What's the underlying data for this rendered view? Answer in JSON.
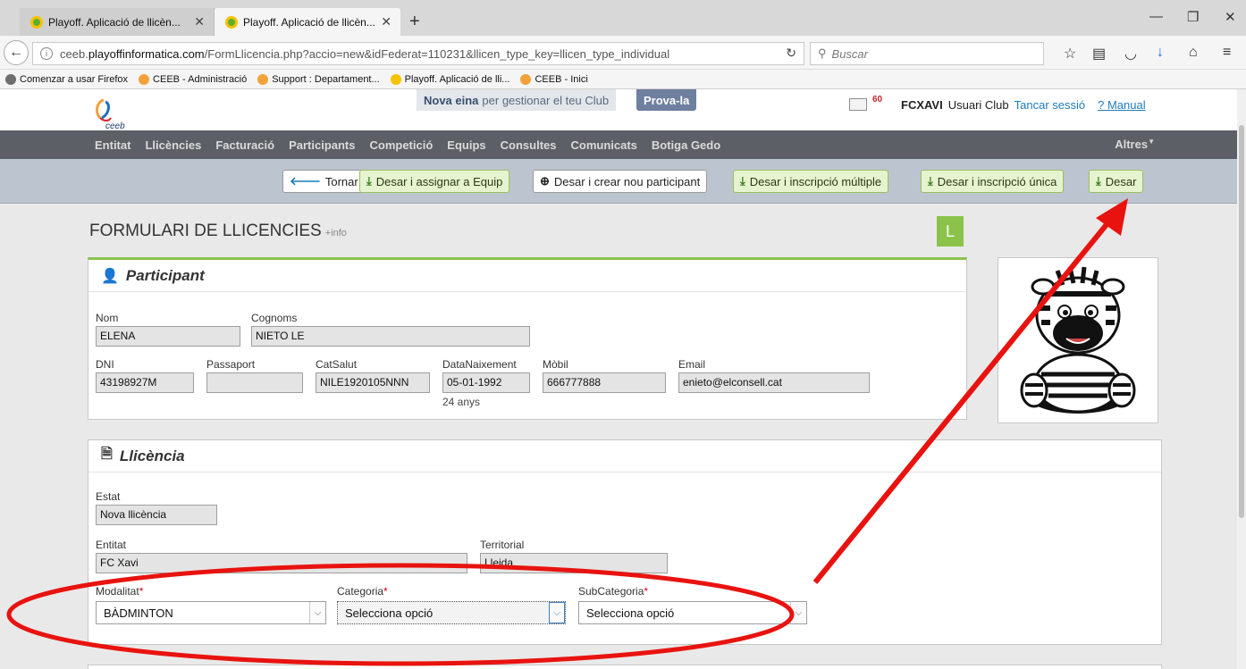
{
  "browser": {
    "tabs": [
      {
        "label": "Playoff. Aplicació de llicèn...",
        "active": false
      },
      {
        "label": "Playoff. Aplicació de llicèn...",
        "active": true
      }
    ],
    "url_prefix": "ceeb.",
    "url_domain": "playoffinformatica.com",
    "url_rest": "/FormLlicencia.php?accio=new&idFederat=110231&llicen_type_key=llicen_type_individual",
    "search_placeholder": "Buscar",
    "bookmarks": [
      "Comenzar a usar Firefox",
      "CEEB - Administració",
      "Support : Departament...",
      "Playoff. Aplicació de lli...",
      "CEEB - Inici"
    ]
  },
  "site": {
    "logo_text": "ceeb",
    "promo_bold": "Nova eina",
    "promo_text": "per gestionar el teu Club",
    "promo_button": "Prova-la",
    "mail_count": "60",
    "username": "FCXAVI",
    "role": "Usuari Club",
    "logout": "Tancar sessió",
    "manual": "? Manual"
  },
  "menu": {
    "items": [
      "Entitat",
      "Llicències",
      "Facturació",
      "Participants",
      "Competició",
      "Equips",
      "Consultes",
      "Comunicats",
      "Botiga Gedo"
    ],
    "altres": "Altres"
  },
  "actions": {
    "tornar": "Tornar",
    "assignar": "Desar i assignar a Equip",
    "nou_participant": "Desar i crear nou participant",
    "multiple": "Desar i inscripció múltiple",
    "unica": "Desar i inscripció única",
    "desar": "Desar"
  },
  "form": {
    "title": "FORMULARI DE LLICENCIES",
    "info": "+info",
    "badge": "L"
  },
  "participant": {
    "heading": "Participant",
    "nom": {
      "label": "Nom",
      "value": "ELENA"
    },
    "cognoms": {
      "label": "Cognoms",
      "value": "NIETO LE"
    },
    "dni": {
      "label": "DNI",
      "value": "43198927M"
    },
    "passaport": {
      "label": "Passaport",
      "value": ""
    },
    "catsalut": {
      "label": "CatSalut",
      "value": "NILE1920105NNN"
    },
    "naixement": {
      "label": "DataNaixement",
      "value": "05-01-1992",
      "age": "24 anys"
    },
    "mobil": {
      "label": "Mòbil",
      "value": "666777888"
    },
    "email": {
      "label": "Email",
      "value": "enieto@elconsell.cat"
    }
  },
  "llicencia": {
    "heading": "Llicència",
    "estat": {
      "label": "Estat",
      "value": "Nova llicència"
    },
    "entitat": {
      "label": "Entitat",
      "value": "FC Xavi"
    },
    "territorial": {
      "label": "Territorial",
      "value": "Lleida"
    },
    "modalitat": {
      "label": "Modalitat",
      "value": "BÀDMINTON"
    },
    "categoria": {
      "label": "Categoria",
      "value": "Selecciona opció"
    },
    "subcategoria": {
      "label": "SubCategoria",
      "value": "Selecciona opció"
    },
    "required_mark": "*"
  },
  "annotation": {
    "color": "#e8130f"
  },
  "colors": {
    "menu_bg": "#5c6066",
    "action_bg": "#bcc4cf",
    "accent_green": "#8bc34a",
    "link_blue": "#1f7cbf"
  }
}
